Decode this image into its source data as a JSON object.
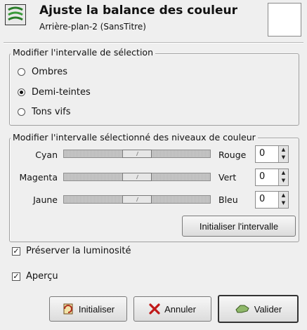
{
  "header": {
    "title": "Ajuste la balance des couleur",
    "subtitle": "Arrière-plan-2 (SansTitre)",
    "icon": "color-balance-icon"
  },
  "range_frame": {
    "label": "Modifier l'intervalle de sélection",
    "options": [
      {
        "label": "Ombres",
        "selected": false
      },
      {
        "label": "Demi-teintes",
        "selected": true
      },
      {
        "label": "Tons vifs",
        "selected": false
      }
    ]
  },
  "levels_frame": {
    "label": "Modifier l'intervalle sélectionné des niveaux de couleur",
    "sliders": [
      {
        "left": "Cyan",
        "right": "Rouge",
        "value": "0",
        "level": 0.5
      },
      {
        "left": "Magenta",
        "right": "Vert",
        "value": "0",
        "level": 0.5
      },
      {
        "left": "Jaune",
        "right": "Bleu",
        "value": "0",
        "level": 0.5
      }
    ],
    "reset_range_label": "Initialiser l'intervalle"
  },
  "options": {
    "preserve_luminosity": {
      "label": "Préserver la luminosité",
      "checked": true
    },
    "preview": {
      "label": "Aperçu",
      "checked": true
    }
  },
  "buttons": {
    "reset": {
      "label": "Initialiser",
      "icon": "reset-icon"
    },
    "cancel": {
      "label": "Annuler",
      "icon": "cancel-x-icon"
    },
    "ok": {
      "label": "Valider",
      "icon": "ok-hand-icon"
    }
  }
}
